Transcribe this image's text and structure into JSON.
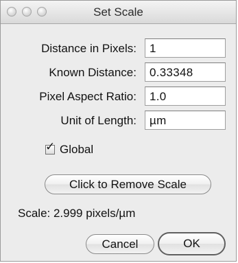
{
  "window": {
    "title": "Set Scale",
    "controls": [
      "close-icon",
      "minimize-icon",
      "zoom-icon"
    ]
  },
  "form": {
    "fields": [
      {
        "label": "Distance in Pixels:",
        "value": "1"
      },
      {
        "label": "Known Distance:",
        "value": "0.33348"
      },
      {
        "label": "Pixel Aspect Ratio:",
        "value": "1.0"
      },
      {
        "label": "Unit of Length:",
        "value": "µm"
      }
    ],
    "global": {
      "label": "Global",
      "checked": true
    }
  },
  "buttons": {
    "remove_scale": "Click to Remove Scale",
    "cancel": "Cancel",
    "ok": "OK"
  },
  "status": {
    "scale": "Scale: 2.999 pixels/µm"
  }
}
